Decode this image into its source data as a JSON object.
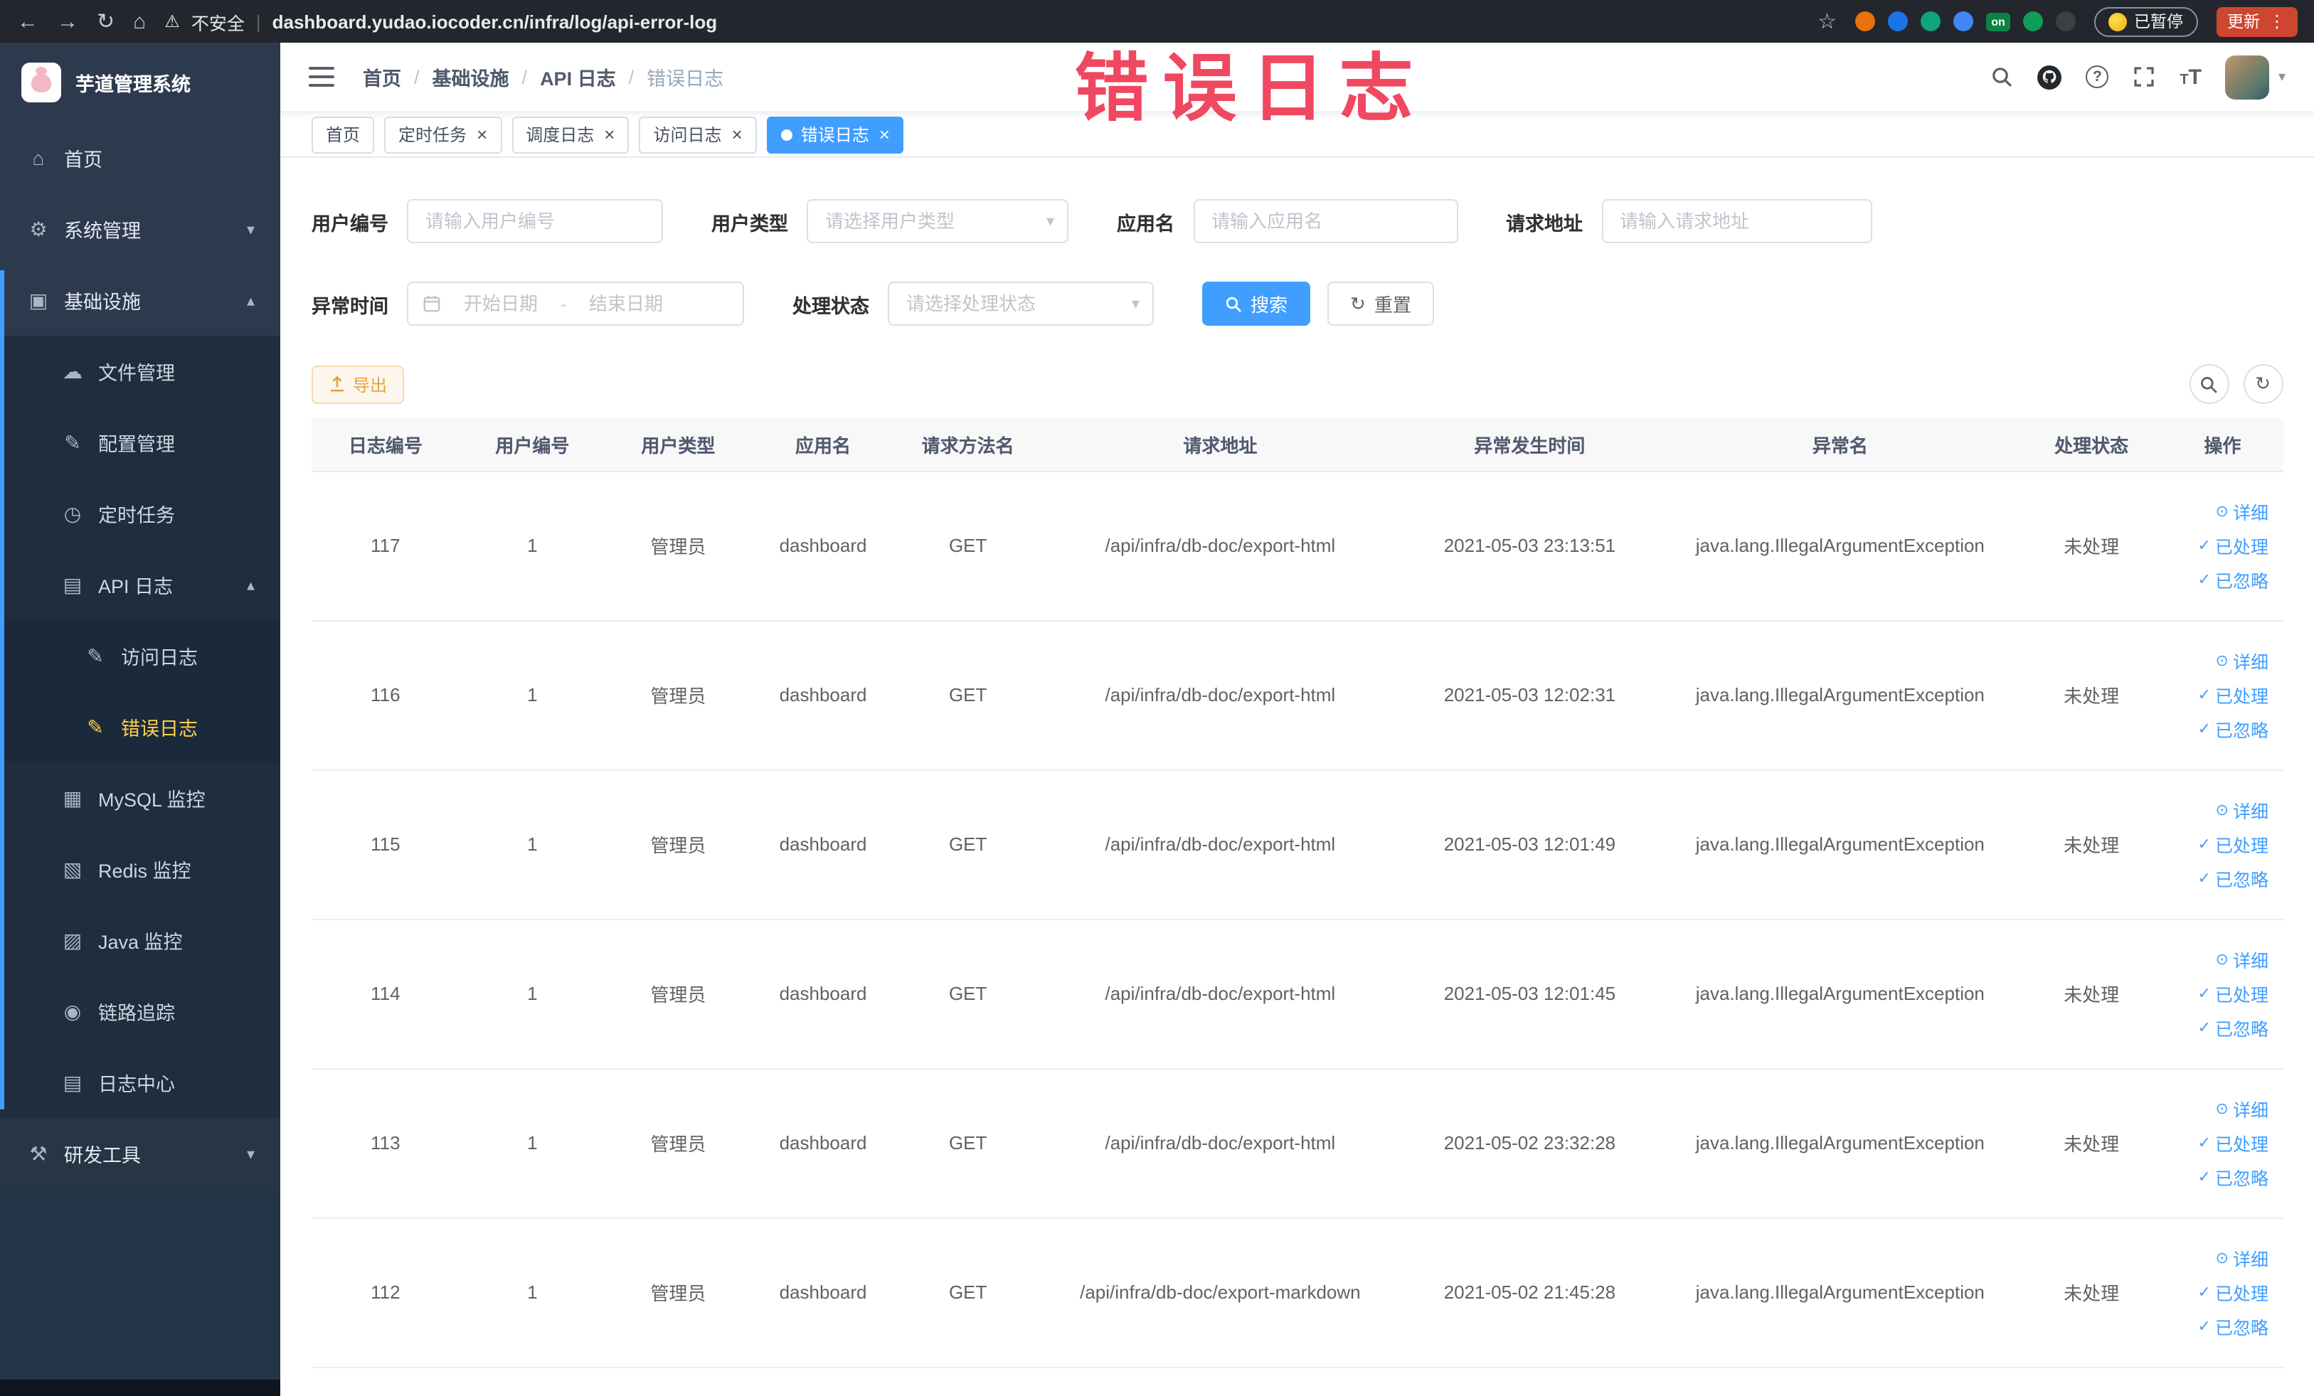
{
  "watermark": "错误日志",
  "colors": {
    "primary": "#409eff",
    "menu-active": "#ffd04b",
    "warning": "#e6a23c",
    "watermark": "#ef4860"
  },
  "browser": {
    "warning_label": "不安全",
    "url": "dashboard.yudao.iocoder.cn/infra/log/api-error-log",
    "paused_badge": "已暂停",
    "update_label": "更新",
    "extensions": [
      {
        "name": "extension-orange-icon",
        "color": "#e8710a"
      },
      {
        "name": "extension-blue-drop-icon",
        "color": "#1a73e8"
      },
      {
        "name": "extension-green-circle-icon",
        "color": "#10a37f"
      },
      {
        "name": "extension-grid-icon",
        "color": "#4285f4"
      },
      {
        "name": "extension-on-badge",
        "color": "#0c8346",
        "text": "on"
      },
      {
        "name": "extension-leaf-icon",
        "color": "#0f9d58"
      },
      {
        "name": "extension-dark-icon",
        "color": "#3c4043"
      }
    ]
  },
  "sidebar": {
    "logo_title": "芋道管理系统",
    "menu": [
      {
        "key": "home",
        "label": "首页",
        "icon": "home-icon",
        "depth": 0
      },
      {
        "key": "system",
        "label": "系统管理",
        "icon": "gear-icon",
        "depth": 0,
        "arrow": "down"
      },
      {
        "key": "infra",
        "label": "基础设施",
        "icon": "monitor-icon",
        "depth": 0,
        "arrow": "up"
      },
      {
        "key": "file",
        "label": "文件管理",
        "icon": "cloud-icon",
        "depth": 1,
        "sub": true
      },
      {
        "key": "config",
        "label": "配置管理",
        "icon": "edit-icon",
        "depth": 1,
        "sub": true
      },
      {
        "key": "job",
        "label": "定时任务",
        "icon": "clock-icon",
        "depth": 1,
        "sub": true
      },
      {
        "key": "api-log",
        "label": "API 日志",
        "icon": "log-icon",
        "depth": 1,
        "sub": true,
        "arrow": "up"
      },
      {
        "key": "access-log",
        "label": "访问日志",
        "icon": "doc-icon",
        "depth": 2,
        "sub": true
      },
      {
        "key": "error-log",
        "label": "错误日志",
        "icon": "doc-icon",
        "depth": 2,
        "sub": true,
        "active": true
      },
      {
        "key": "mysql",
        "label": "MySQL 监控",
        "icon": "chart-icon",
        "depth": 1,
        "sub": true
      },
      {
        "key": "redis",
        "label": "Redis 监控",
        "icon": "layers-icon",
        "depth": 1,
        "sub": true
      },
      {
        "key": "java",
        "label": "Java 监控",
        "icon": "screen-icon",
        "depth": 1,
        "sub": true
      },
      {
        "key": "trace",
        "label": "链路追踪",
        "icon": "eye-icon",
        "depth": 1,
        "sub": true
      },
      {
        "key": "log-center",
        "label": "日志中心",
        "icon": "log-icon",
        "depth": 1,
        "sub": true
      },
      {
        "key": "dev-tools",
        "label": "研发工具",
        "icon": "tools-icon",
        "depth": 0,
        "arrow": "down",
        "dark": true
      }
    ]
  },
  "breadcrumb": [
    "首页",
    "基础设施",
    "API 日志",
    "错误日志"
  ],
  "tabs": [
    {
      "key": "home",
      "label": "首页",
      "closable": false,
      "active": false
    },
    {
      "key": "job",
      "label": "定时任务",
      "closable": true,
      "active": false
    },
    {
      "key": "job-log",
      "label": "调度日志",
      "closable": true,
      "active": false
    },
    {
      "key": "access-log",
      "label": "访问日志",
      "closable": true,
      "active": false
    },
    {
      "key": "error-log",
      "label": "错误日志",
      "closable": true,
      "active": true
    }
  ],
  "filters": {
    "user_id_label": "用户编号",
    "user_id_placeholder": "请输入用户编号",
    "user_type_label": "用户类型",
    "user_type_placeholder": "请选择用户类型",
    "app_name_label": "应用名",
    "app_name_placeholder": "请输入应用名",
    "request_url_label": "请求地址",
    "request_url_placeholder": "请输入请求地址",
    "exception_time_label": "异常时间",
    "date_start_placeholder": "开始日期",
    "date_separator": "-",
    "date_end_placeholder": "结束日期",
    "process_status_label": "处理状态",
    "process_status_placeholder": "请选择处理状态",
    "search_label": "搜索",
    "reset_label": "重置"
  },
  "toolbar": {
    "export_label": "导出"
  },
  "table": {
    "columns": [
      "日志编号",
      "用户编号",
      "用户类型",
      "应用名",
      "请求方法名",
      "请求地址",
      "异常发生时间",
      "异常名",
      "处理状态",
      "操作"
    ],
    "row_actions": [
      "详细",
      "已处理",
      "已忽略"
    ],
    "rows": [
      {
        "log_id": "117",
        "user_id": "1",
        "user_type": "管理员",
        "app_name": "dashboard",
        "method": "GET",
        "url": "/api/infra/db-doc/export-html",
        "time": "2021-05-03 23:13:51",
        "exception": "java.lang.IllegalArgumentException",
        "status": "未处理"
      },
      {
        "log_id": "116",
        "user_id": "1",
        "user_type": "管理员",
        "app_name": "dashboard",
        "method": "GET",
        "url": "/api/infra/db-doc/export-html",
        "time": "2021-05-03 12:02:31",
        "exception": "java.lang.IllegalArgumentException",
        "status": "未处理"
      },
      {
        "log_id": "115",
        "user_id": "1",
        "user_type": "管理员",
        "app_name": "dashboard",
        "method": "GET",
        "url": "/api/infra/db-doc/export-html",
        "time": "2021-05-03 12:01:49",
        "exception": "java.lang.IllegalArgumentException",
        "status": "未处理"
      },
      {
        "log_id": "114",
        "user_id": "1",
        "user_type": "管理员",
        "app_name": "dashboard",
        "method": "GET",
        "url": "/api/infra/db-doc/export-html",
        "time": "2021-05-03 12:01:45",
        "exception": "java.lang.IllegalArgumentException",
        "status": "未处理"
      },
      {
        "log_id": "113",
        "user_id": "1",
        "user_type": "管理员",
        "app_name": "dashboard",
        "method": "GET",
        "url": "/api/infra/db-doc/export-html",
        "time": "2021-05-02 23:32:28",
        "exception": "java.lang.IllegalArgumentException",
        "status": "未处理"
      },
      {
        "log_id": "112",
        "user_id": "1",
        "user_type": "管理员",
        "app_name": "dashboard",
        "method": "GET",
        "url": "/api/infra/db-doc/export-markdown",
        "time": "2021-05-02 21:45:28",
        "exception": "java.lang.IllegalArgumentException",
        "status": "未处理"
      }
    ]
  }
}
